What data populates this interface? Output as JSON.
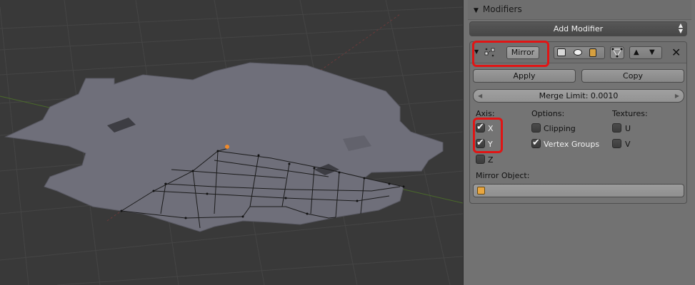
{
  "panel": {
    "title": "Modifiers"
  },
  "add_modifier": {
    "label": "Add Modifier"
  },
  "modifier": {
    "name": "Mirror",
    "apply_label": "Apply",
    "copy_label": "Copy",
    "merge_limit": "Merge Limit: 0.0010",
    "axis_heading": "Axis:",
    "options_heading": "Options:",
    "textures_heading": "Textures:",
    "axis": [
      {
        "label": "X",
        "checked": true
      },
      {
        "label": "Y",
        "checked": true
      },
      {
        "label": "Z",
        "checked": false
      }
    ],
    "options": [
      {
        "label": "Clipping",
        "checked": false
      },
      {
        "label": "Vertex Groups",
        "checked": true
      }
    ],
    "textures": [
      {
        "label": "U",
        "checked": false
      },
      {
        "label": "V",
        "checked": false
      }
    ],
    "mirror_object_label": "Mirror Object:"
  },
  "colors": {
    "highlight": "#e01515",
    "viewport_bg": "#393939",
    "mesh": "#6f6f7a"
  }
}
